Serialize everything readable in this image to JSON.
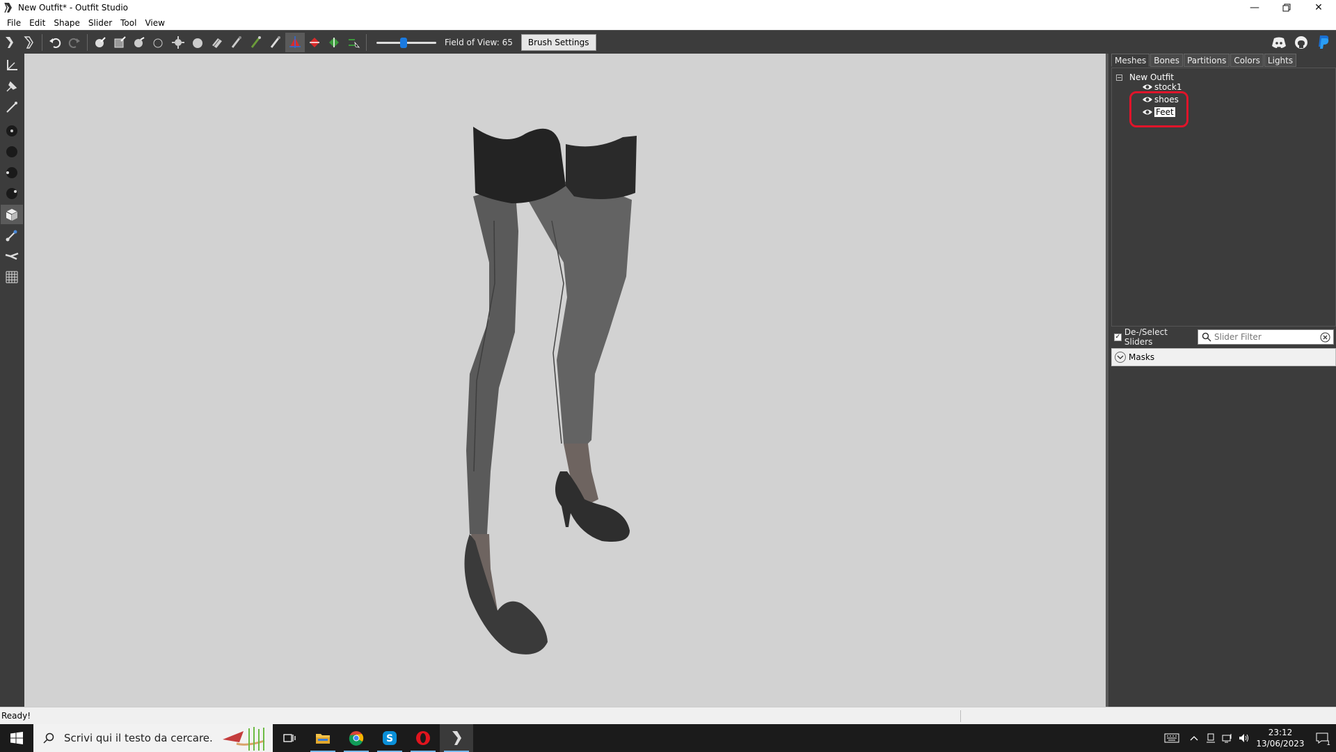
{
  "window": {
    "title": "New Outfit* - Outfit Studio",
    "minimize_icon": "minimize-icon",
    "maximize_icon": "restore-icon",
    "close_icon": "close-icon"
  },
  "menu": [
    "File",
    "Edit",
    "Shape",
    "Slider",
    "Tool",
    "View"
  ],
  "toolbar": {
    "fov_label": "Field of View: 65",
    "fov_value": 65,
    "brush_settings_label": "Brush Settings",
    "icons": [
      "select-icon",
      "transform-icon",
      "undo-icon",
      "redo-icon",
      "brush-standard-icon",
      "mask-brush-icon",
      "inflate-brush-icon",
      "deflate-brush-icon",
      "move-brush-icon",
      "smooth-brush-icon",
      "undiff-brush-icon",
      "weight-brush-icon",
      "color-brush-icon",
      "alpha-brush-icon",
      "x-mirror-icon",
      "connected-only-icon",
      "global-brush-icon",
      "restrict-plane-icon"
    ],
    "social_icons": [
      "discord-icon",
      "github-icon",
      "paypal-icon"
    ]
  },
  "left_tools": [
    "transform-icon",
    "pivot-icon",
    "vertex-select-icon",
    "small-dot-icon",
    "medium-dot-icon",
    "large-dot-icon",
    "xl-dot-icon",
    "shaded-cube-icon",
    "bone-icon",
    "bone-alt-icon",
    "grid-icon"
  ],
  "right_panel": {
    "tabs": [
      "Meshes",
      "Bones",
      "Partitions",
      "Colors",
      "Lights"
    ],
    "active_tab": "Meshes",
    "tree": {
      "root": "New Outfit",
      "meshes": [
        "stock1",
        "shoes",
        "Feet"
      ],
      "selected": "Feet"
    },
    "deselect_sliders_label": "De-/Select Sliders",
    "deselect_checked": true,
    "slider_filter_placeholder": "Slider Filter",
    "masks_label": "Masks"
  },
  "status": "Ready!",
  "taskbar": {
    "search_placeholder": "Scrivi qui il testo da cercare.",
    "apps": [
      "task-view-icon",
      "file-explorer-icon",
      "chrome-icon",
      "skype-icon",
      "opera-icon",
      "outfit-studio-icon"
    ],
    "time": "23:12",
    "date": "13/06/2023",
    "notification_count": "1"
  },
  "colors": {
    "toolbar_bg": "#3c3c3c",
    "viewport_bg": "#d2d2d2",
    "highlight": "#e0142a",
    "accent": "#1a7ae0"
  }
}
